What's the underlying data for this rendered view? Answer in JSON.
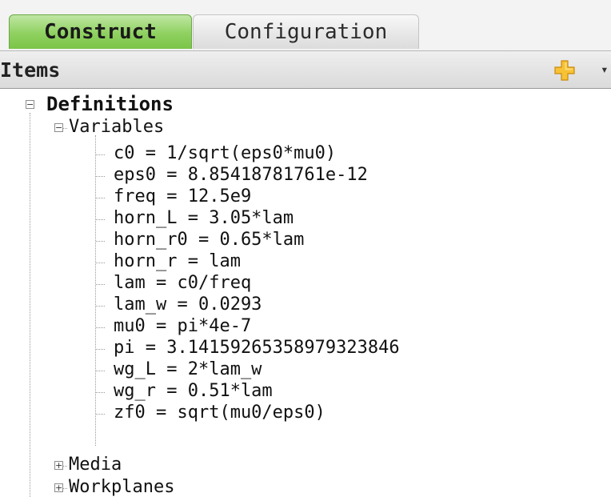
{
  "tabs": [
    {
      "label": "Construct",
      "active": true
    },
    {
      "label": "Configuration",
      "active": false
    }
  ],
  "items_header": {
    "title": "Items",
    "add_icon": "plus-icon",
    "caret_icon": "chevron-down-icon",
    "caret_glyph": "▾"
  },
  "tree": {
    "root": {
      "label": "Definitions",
      "expanded": true
    },
    "variables": {
      "label": "Variables",
      "expanded": true,
      "items": [
        "c0 = 1/sqrt(eps0*mu0)",
        "eps0 = 8.85418781761e-12",
        "freq = 12.5e9",
        "horn_L = 3.05*lam",
        "horn_r0 = 0.65*lam",
        "horn_r = lam",
        "lam = c0/freq",
        "lam_w = 0.0293",
        "mu0 = pi*4e-7",
        "pi = 3.14159265358979323846",
        "wg_L = 2*lam_w",
        "wg_r = 0.51*lam",
        "zf0 = sqrt(mu0/eps0)"
      ]
    },
    "media": {
      "label": "Media",
      "expanded": false
    },
    "workplanes": {
      "label": "Workplanes",
      "expanded": false
    },
    "toggle_collapse": "−",
    "toggle_expand": "+"
  },
  "colors": {
    "active_tab": "#8fd160",
    "plus_icon": "#f2b21c"
  }
}
